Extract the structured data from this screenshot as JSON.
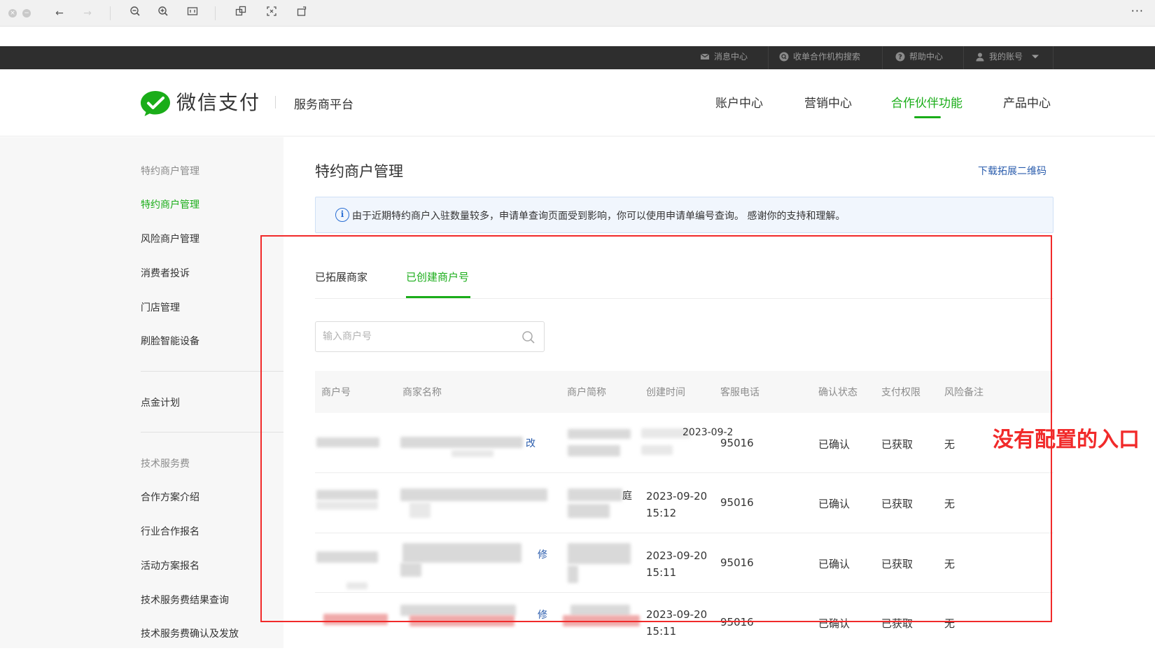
{
  "top_bar": {
    "links": [
      {
        "label": "消息中心",
        "icon": "mail-icon"
      },
      {
        "label": "收单合作机构搜索",
        "icon": "search-circle-icon"
      },
      {
        "label": "帮助中心",
        "icon": "help-icon"
      },
      {
        "label": "我的账号",
        "icon": "user-icon"
      }
    ]
  },
  "header": {
    "logo_text": "微信支付",
    "platform": "服务商平台",
    "nav": [
      "账户中心",
      "营销中心",
      "合作伙伴功能",
      "产品中心"
    ],
    "active_nav": "合作伙伴功能"
  },
  "sidebar": {
    "group1_heading": "特约商户管理",
    "group1_items": [
      "特约商户管理",
      "风险商户管理",
      "消费者投诉",
      "门店管理",
      "刷脸智能设备"
    ],
    "active_item": "特约商户管理",
    "group2_items": [
      "点金计划"
    ],
    "group3_heading": "技术服务费",
    "group3_items": [
      "合作方案介绍",
      "行业合作报名",
      "活动方案报名",
      "技术服务费结果查询",
      "技术服务费确认及发放"
    ]
  },
  "main": {
    "title": "特约商户管理",
    "download_link": "下载拓展二维码",
    "notice": "由于近期特约商户入驻数量较多，申请单查询页面受到影响，你可以使用申请单编号查询。 感谢你的支持和理解。",
    "tabs": [
      "已拓展商家",
      "已创建商户号"
    ],
    "active_tab": "已创建商户号",
    "search_placeholder": "输入商户号",
    "columns": [
      "商户号",
      "商家名称",
      "商户简称",
      "创建时间",
      "客服电话",
      "确认状态",
      "支付权限",
      "风险备注"
    ],
    "rows": [
      {
        "time_line1": "2023-09-2",
        "time_line2": "",
        "phone": "95016",
        "status": "已确认",
        "permission": "已获取",
        "risk": "无",
        "edit": "改",
        "short_suffix": ""
      },
      {
        "time_line1": "2023-09-20",
        "time_line2": "15:12",
        "phone": "95016",
        "status": "已确认",
        "permission": "已获取",
        "risk": "无",
        "edit": "",
        "short_suffix": "庭"
      },
      {
        "time_line1": "2023-09-20",
        "time_line2": "15:11",
        "phone": "95016",
        "status": "已确认",
        "permission": "已获取",
        "risk": "无",
        "edit": "修",
        "short_suffix": ""
      },
      {
        "time_line1": "2023-09-20",
        "time_line2": "15:11",
        "phone": "95016",
        "status": "已确认",
        "permission": "已获取",
        "risk": "无",
        "edit": "修",
        "short_suffix": ""
      }
    ]
  },
  "annotation": {
    "text": "没有配置的入口",
    "color": "#f12a2a"
  },
  "colors": {
    "accent": "#1aad19",
    "link": "#2b5dad",
    "top_bar": "#2e2e2e"
  }
}
